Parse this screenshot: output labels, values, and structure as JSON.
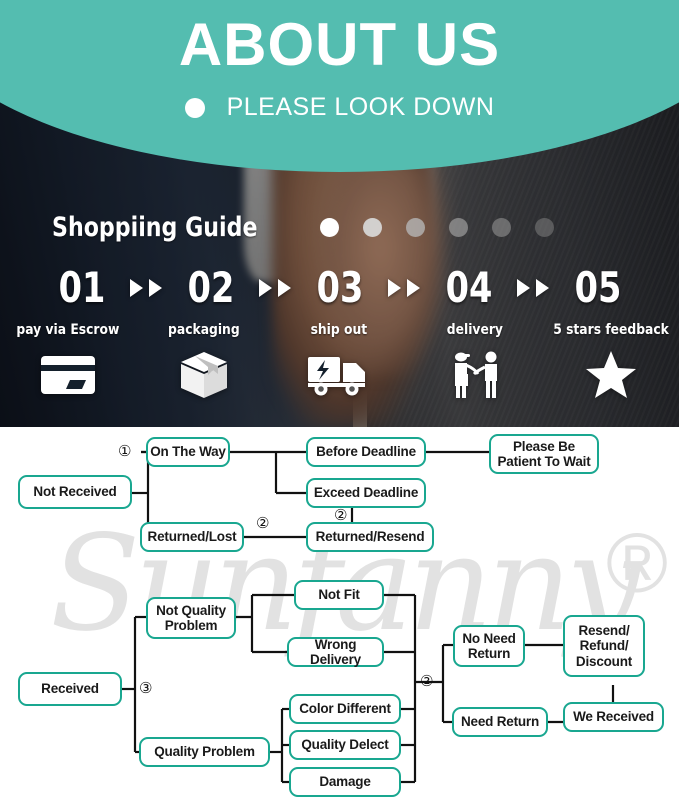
{
  "hero": {
    "title": "ABOUT US",
    "subtitle": "PLEASE LOOK DOWN",
    "bullet_icon": "filled-circle-icon",
    "accent_color": "#54bdb0",
    "guide_title": "Shoppiing Guide",
    "progress_dots": [
      {
        "color": "#ffffff",
        "opacity": 1.0
      },
      {
        "color": "#d9d9d9",
        "opacity": 0.92
      },
      {
        "color": "#b5b5b5",
        "opacity": 0.8
      },
      {
        "color": "#9e9e9e",
        "opacity": 0.7
      },
      {
        "color": "#8f8f8f",
        "opacity": 0.62
      },
      {
        "color": "#808080",
        "opacity": 0.55
      }
    ],
    "steps": [
      {
        "number": "01",
        "label": "pay via Escrow",
        "icon": "credit-card-icon"
      },
      {
        "number": "02",
        "label": "packaging",
        "icon": "package-box-icon"
      },
      {
        "number": "03",
        "label": "ship out",
        "icon": "delivery-truck-icon"
      },
      {
        "number": "04",
        "label": "delivery",
        "icon": "handover-people-icon"
      },
      {
        "number": "05",
        "label": "5 stars feedback",
        "icon": "star-icon"
      }
    ],
    "arrow_icon": "triangle-right-icon"
  },
  "flowchart": {
    "watermark": "Sunfanny",
    "watermark_mark": "®",
    "node_border_color": "#19a790",
    "nodes": [
      {
        "id": "not-received",
        "label": "Not Received"
      },
      {
        "id": "on-the-way",
        "label": "On The Way"
      },
      {
        "id": "returned-lost",
        "label": "Returned/Lost"
      },
      {
        "id": "before-deadline",
        "label": "Before Deadline"
      },
      {
        "id": "exceed-deadline",
        "label": "Exceed Deadline"
      },
      {
        "id": "returned-resend",
        "label": "Returned/Resend"
      },
      {
        "id": "please-be-patient",
        "label": "Please Be\nPatient To Wait"
      },
      {
        "id": "received",
        "label": "Received"
      },
      {
        "id": "not-quality-problem",
        "label": "Not Quality\nProblem"
      },
      {
        "id": "quality-problem",
        "label": "Quality Problem"
      },
      {
        "id": "not-fit",
        "label": "Not Fit"
      },
      {
        "id": "wrong-delivery",
        "label": "Wrong Delivery"
      },
      {
        "id": "color-different",
        "label": "Color Different"
      },
      {
        "id": "quality-delect",
        "label": "Quality Delect"
      },
      {
        "id": "damage",
        "label": "Damage"
      },
      {
        "id": "no-need-return",
        "label": "No Need\nReturn"
      },
      {
        "id": "need-return",
        "label": "Need Return"
      },
      {
        "id": "resend-refund-discount",
        "label": "Resend/\nRefund/\nDiscount"
      },
      {
        "id": "we-received",
        "label": "We Received"
      }
    ],
    "markers": [
      {
        "id": "marker-1-not-received",
        "symbol": "①"
      },
      {
        "id": "marker-2-returned-lost",
        "symbol": "②"
      },
      {
        "id": "marker-2-exceed-deadline",
        "symbol": "②"
      },
      {
        "id": "marker-3-received",
        "symbol": "③"
      },
      {
        "id": "marker-2-return-branch",
        "symbol": "②"
      }
    ]
  }
}
